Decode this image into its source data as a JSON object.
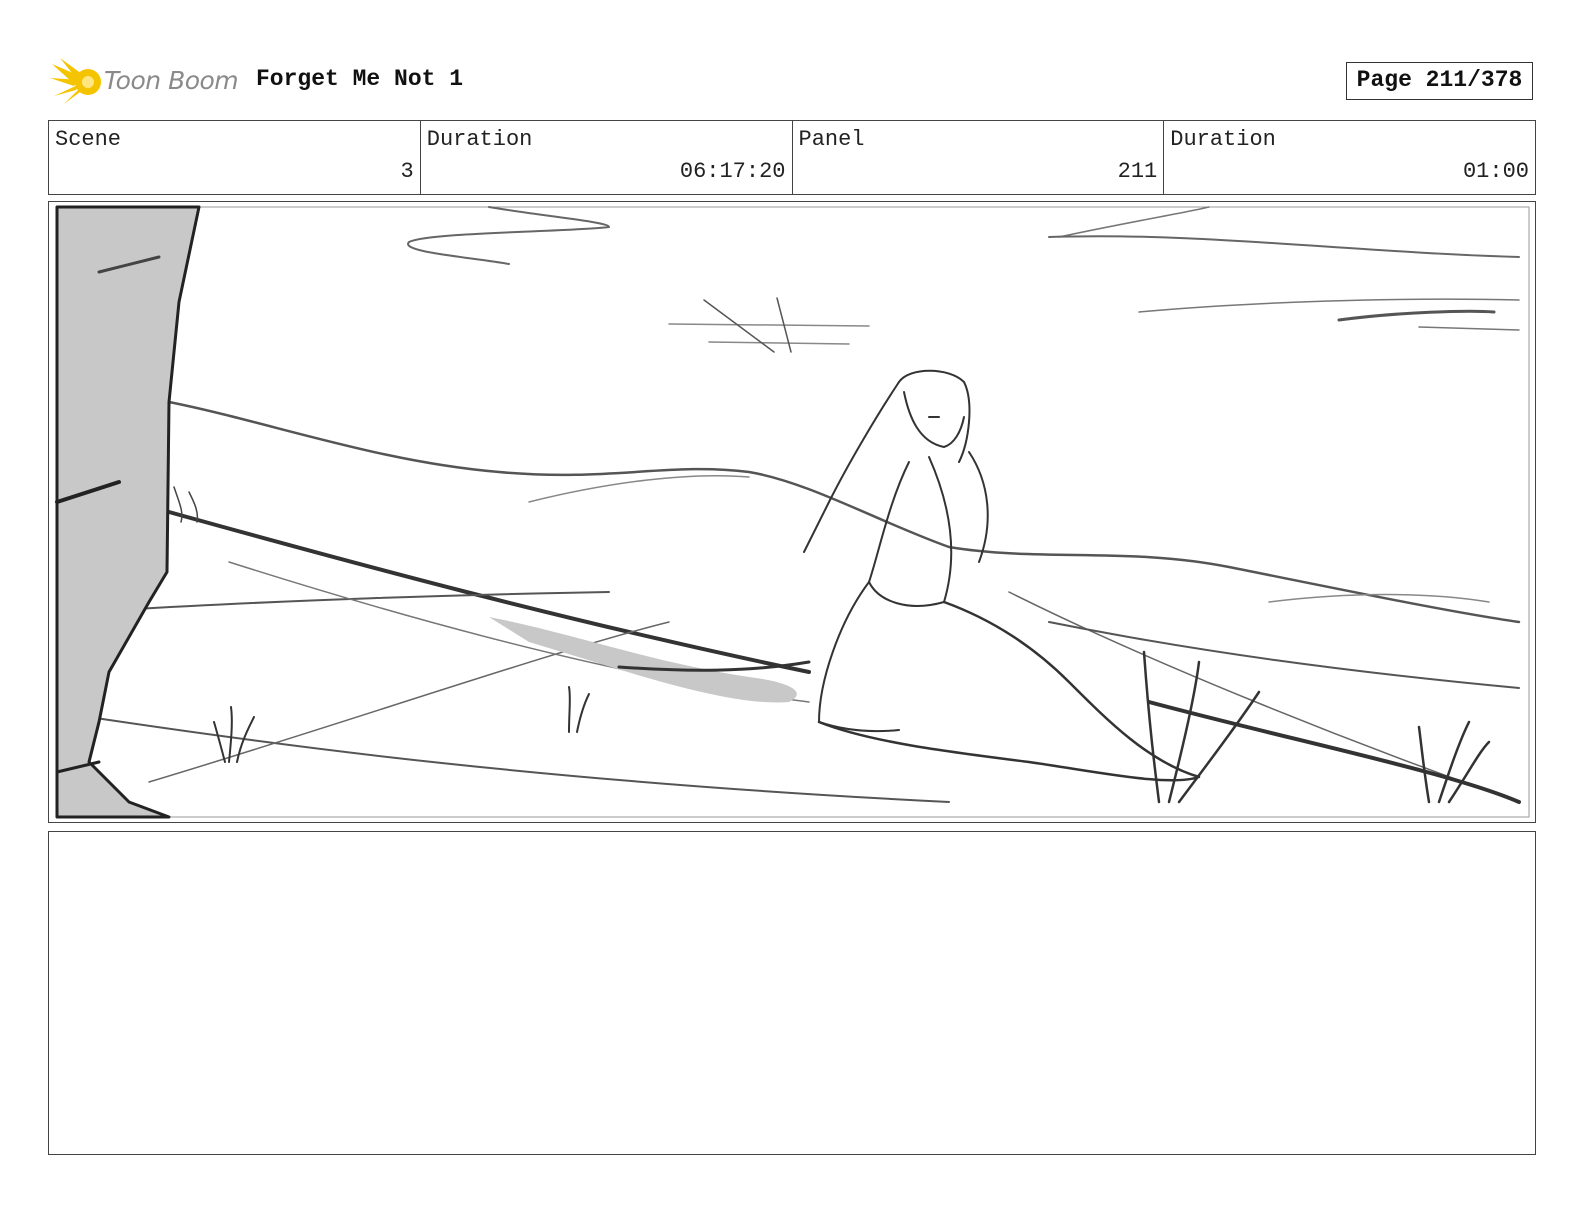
{
  "header": {
    "logo_text": "Toon Boom",
    "title": "Forget Me Not 1",
    "page_label": "Page 211/378"
  },
  "info": {
    "scene_label": "Scene",
    "scene_value": "3",
    "scene_duration_label": "Duration",
    "scene_duration_value": "06:17:20",
    "panel_label": "Panel",
    "panel_value": "211",
    "panel_duration_label": "Duration",
    "panel_duration_value": "01:00"
  },
  "notes": {
    "text": ""
  },
  "colors": {
    "logo_accent": "#f5c400",
    "sketch_line": "#3a3a3a",
    "sketch_shade": "#c8c8c8"
  }
}
